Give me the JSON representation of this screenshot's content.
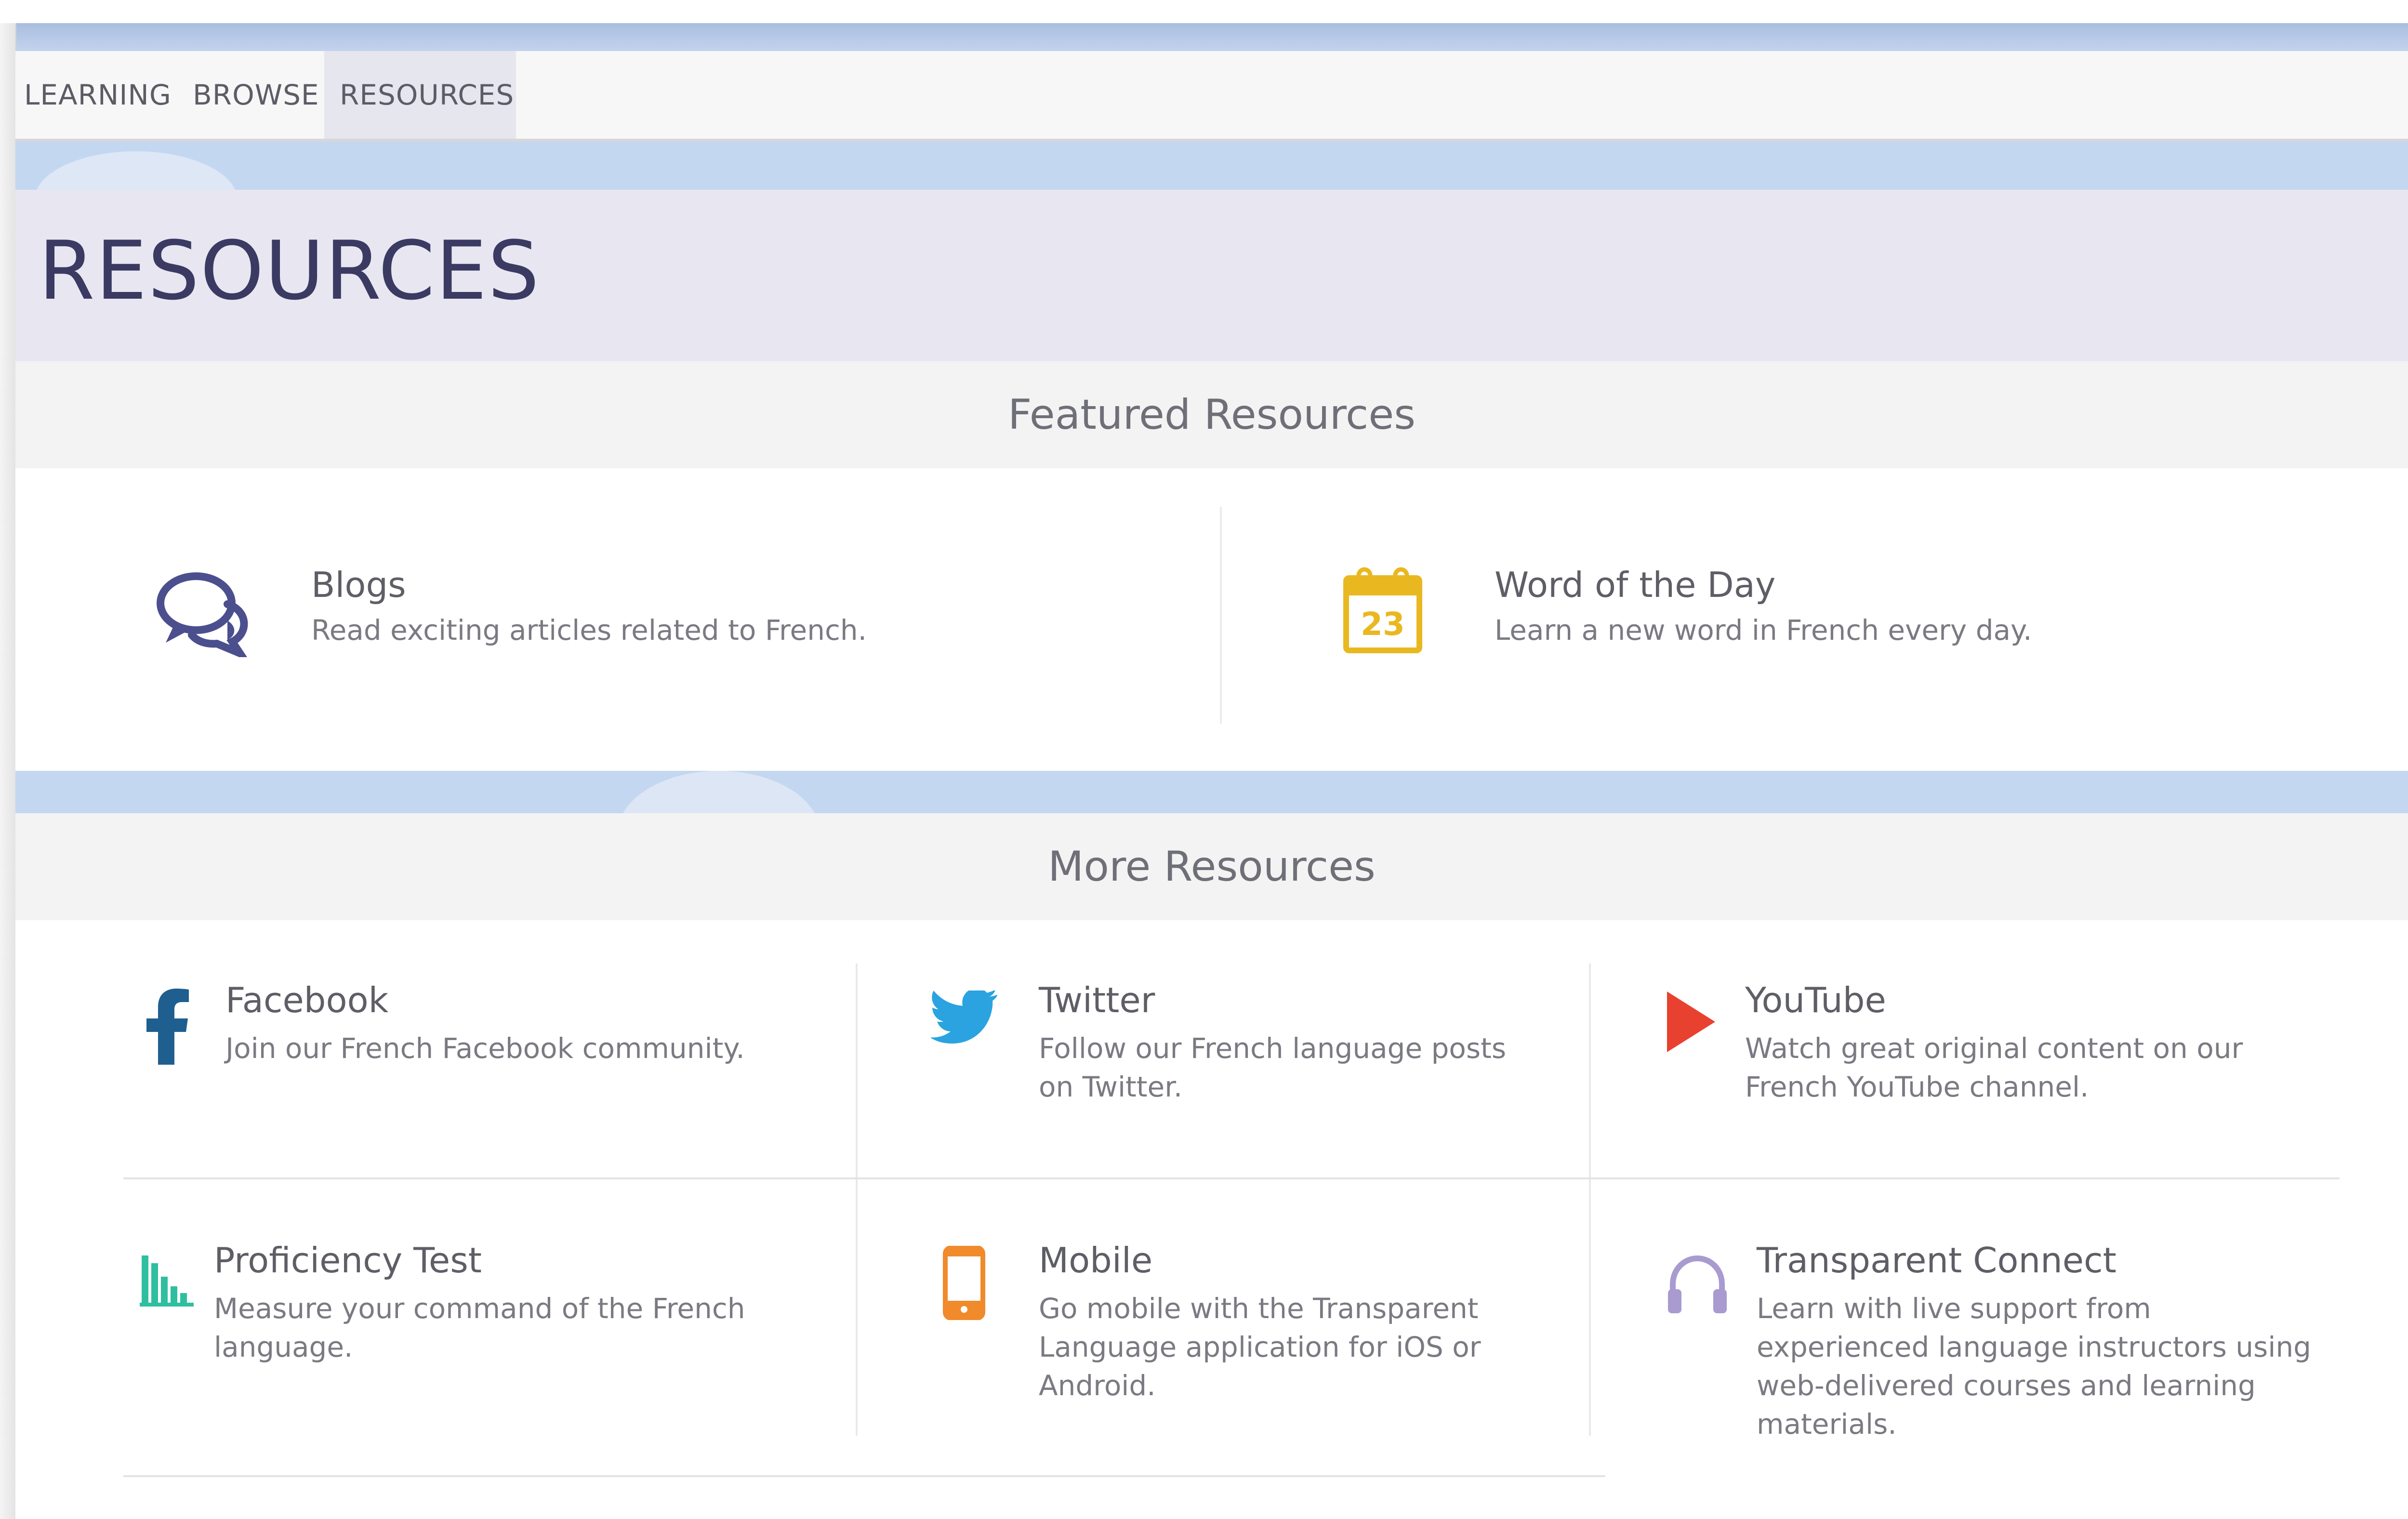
{
  "nav": {
    "items": [
      {
        "label": "LEARNING",
        "active": false
      },
      {
        "label": "BROWSE",
        "active": false
      },
      {
        "label": "RESOURCES",
        "active": true
      }
    ]
  },
  "page": {
    "title": "RESOURCES"
  },
  "featured": {
    "heading": "Featured Resources",
    "items": [
      {
        "icon": "speech-bubbles-icon",
        "title": "Blogs",
        "description": "Read exciting articles related to French."
      },
      {
        "icon": "calendar-icon",
        "icon_text": "23",
        "title": "Word of the Day",
        "description": "Learn a new word in French every day."
      }
    ]
  },
  "more": {
    "heading": "More Resources",
    "items": [
      {
        "icon": "facebook-icon",
        "title": "Facebook",
        "description": "Join our French Facebook community."
      },
      {
        "icon": "twitter-icon",
        "title": "Twitter",
        "description": "Follow our French language posts on Twitter."
      },
      {
        "icon": "youtube-play-icon",
        "title": "YouTube",
        "description": "Watch great original content on our French YouTube channel."
      },
      {
        "icon": "bar-chart-icon",
        "title": "Proficiency Test",
        "description": "Measure your command of the French language."
      },
      {
        "icon": "mobile-phone-icon",
        "title": "Mobile",
        "description": "Go mobile with the Transparent Language application for iOS or Android."
      },
      {
        "icon": "headphones-icon",
        "title": "Transparent Connect",
        "description": "Learn with live support from experienced language instructors using web-delivered courses and learning materials."
      }
    ]
  },
  "colors": {
    "accent_navy": "#3a3a63",
    "icon_blogs": "#4b4f8e",
    "icon_calendar": "#e9b820",
    "icon_facebook": "#1f5f8f",
    "icon_twitter": "#2aa3e0",
    "icon_youtube": "#e8412f",
    "icon_proficiency": "#2fbfa0",
    "icon_mobile": "#f08a2a",
    "icon_headphones": "#a99bd0"
  }
}
